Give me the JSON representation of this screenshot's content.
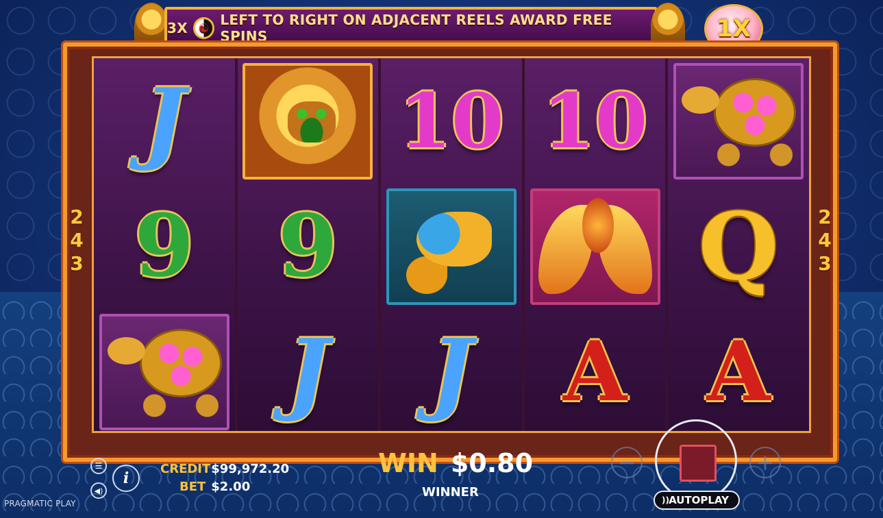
{
  "banner": {
    "prefix": "3X",
    "icon": "yin-yang-icon",
    "text": "LEFT TO RIGHT ON ADJACENT REELS AWARD FREE SPINS"
  },
  "multiplier": "1X",
  "ways": {
    "left": [
      "2",
      "4",
      "3"
    ],
    "right": [
      "2",
      "4",
      "3"
    ]
  },
  "reels": [
    {
      "symbols": [
        {
          "type": "text",
          "value": "J",
          "cls": "J"
        },
        {
          "type": "text",
          "value": "9",
          "cls": "nine"
        },
        {
          "type": "icon",
          "value": "turtle-symbol"
        }
      ]
    },
    {
      "symbols": [
        {
          "type": "icon",
          "value": "lion-symbol"
        },
        {
          "type": "text",
          "value": "9",
          "cls": "nine"
        },
        {
          "type": "text",
          "value": "J",
          "cls": "J"
        }
      ]
    },
    {
      "symbols": [
        {
          "type": "text",
          "value": "10",
          "cls": "ten"
        },
        {
          "type": "icon",
          "value": "koi-fish-symbol"
        },
        {
          "type": "text",
          "value": "J",
          "cls": "J"
        }
      ]
    },
    {
      "symbols": [
        {
          "type": "text",
          "value": "10",
          "cls": "ten"
        },
        {
          "type": "icon",
          "value": "phoenix-symbol"
        },
        {
          "type": "text",
          "value": "A",
          "cls": "A"
        }
      ]
    },
    {
      "symbols": [
        {
          "type": "icon",
          "value": "turtle-symbol"
        },
        {
          "type": "text",
          "value": "Q",
          "cls": "Q"
        },
        {
          "type": "text",
          "value": "A",
          "cls": "A"
        }
      ]
    }
  ],
  "credit": {
    "label": "CREDIT",
    "value": "$99,972.20"
  },
  "bet": {
    "label": "BET",
    "value": "$2.00"
  },
  "win": {
    "label": "WIN",
    "value": "$0.80",
    "status": "WINNER"
  },
  "controls": {
    "autoplay": "AUTOPLAY",
    "info": "i",
    "minus": "−",
    "plus": "+"
  },
  "brand": "PRAGMATIC PLAY"
}
